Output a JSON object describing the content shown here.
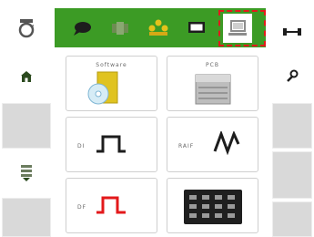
{
  "toolbar": {
    "background": "#3c9b25",
    "buttons": [
      {
        "icon": "chat-bubble-icon"
      },
      {
        "icon": "device-icon"
      },
      {
        "icon": "group-icon"
      },
      {
        "icon": "monitor-icon"
      },
      {
        "icon": "computer-icon",
        "selected": true
      }
    ],
    "selection_color": "#e3191b"
  },
  "left_rail": {
    "items": [
      {
        "icon": "refresh-icon"
      },
      {
        "icon": "home-icon"
      },
      {
        "icon": "list-icon"
      }
    ]
  },
  "right_rail": {
    "items": [
      {
        "icon": "link-icon"
      },
      {
        "icon": "key-icon"
      }
    ]
  },
  "cards": [
    {
      "label": "Software",
      "icon": "software-disk-icon"
    },
    {
      "label": "PCB",
      "icon": "pcb-board-icon"
    },
    {
      "label": "DI",
      "icon": "digital-input-signal-icon"
    },
    {
      "label": "RAIF",
      "icon": "raif-wave-icon"
    },
    {
      "label": "DF",
      "icon": "pulse-signal-icon"
    },
    {
      "label": "",
      "icon": "keypad-grid-icon"
    }
  ]
}
